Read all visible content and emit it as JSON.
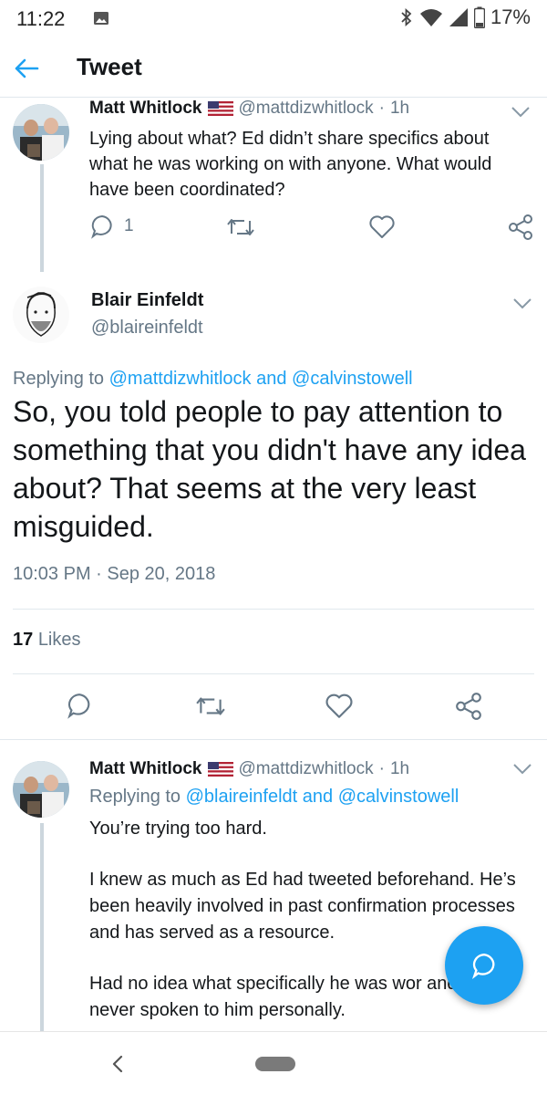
{
  "status_bar": {
    "time": "11:22",
    "battery": "17%",
    "icons": [
      "image-icon",
      "bluetooth-icon",
      "wifi-icon",
      "signal-icon",
      "battery-icon"
    ]
  },
  "app_bar": {
    "title": "Tweet",
    "back_icon": "back-arrow-icon"
  },
  "tweets": [
    {
      "name": "Matt Whitlock",
      "flag": "us-flag",
      "handle": "@mattdizwhitlock",
      "sep": "·",
      "time": "1h",
      "text": "Lying about what? Ed didn’t share specifics about what he was working on with anyone. What would have been coordinated?",
      "reply_count": "1"
    }
  ],
  "main_tweet": {
    "name": "Blair Einfeldt",
    "handle": "@blaireinfeldt",
    "replying_prefix": "Replying to",
    "replying_user1": "@mattdizwhitlock",
    "replying_and": "and",
    "replying_user2": "@calvinstowell",
    "text": "So, you told people to pay attention to something that you didn't have any idea about? That seems at the very least misguided.",
    "timestamp": "10:03 PM · Sep 20, 2018",
    "likes_count": "17",
    "likes_label": "Likes"
  },
  "reply_tweet": {
    "name": "Matt Whitlock",
    "handle": "@mattdizwhitlock",
    "sep": "·",
    "time": "1h",
    "replying_prefix": "Replying to",
    "replying_user1": "@blaireinfeldt",
    "replying_and": "and",
    "replying_user2": "@calvinstowell",
    "paragraphs": [
      "You’re trying too hard.",
      "I knew as much as Ed had tweeted beforehand. He’s been heavily involved in past confirmation processes and has served as a resource.",
      "Had no idea what specifically he was wor and have never spoken to him personally."
    ]
  },
  "colors": {
    "accent": "#1da1f2",
    "text": "#14171a",
    "secondary": "#657786",
    "divider": "#e1e8ed"
  }
}
